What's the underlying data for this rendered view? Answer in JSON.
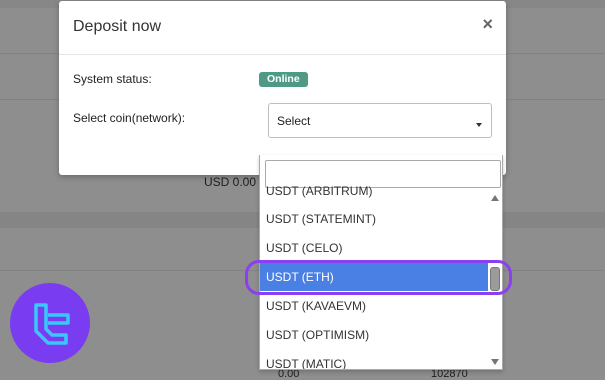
{
  "modal": {
    "title": "Deposit now",
    "close_label": "×",
    "system_status_label": "System status:",
    "system_status_value": "Online",
    "select_coin_label": "Select coin(network):",
    "select_value": "Select"
  },
  "background": {
    "balance_text": "USD 0.00",
    "row_value": "0.00",
    "row_number": "102870"
  },
  "dropdown": {
    "search_value": "",
    "items": [
      {
        "label": "USDT (ARBITRUM)",
        "selected": false
      },
      {
        "label": "USDT (STATEMINT)",
        "selected": false
      },
      {
        "label": "USDT (CELO)",
        "selected": false
      },
      {
        "label": "USDT (ETH)",
        "selected": true
      },
      {
        "label": "USDT (KAVAEVM)",
        "selected": false
      },
      {
        "label": "USDT (OPTIMISM)",
        "selected": false
      },
      {
        "label": "USDT (MATIC)",
        "selected": false
      }
    ]
  },
  "colors": {
    "status_badge": "#4f9a86",
    "selected_item": "#4a7fe4",
    "highlight_ring": "#8a3ff0",
    "logo_bg": "#7a3cf0"
  }
}
